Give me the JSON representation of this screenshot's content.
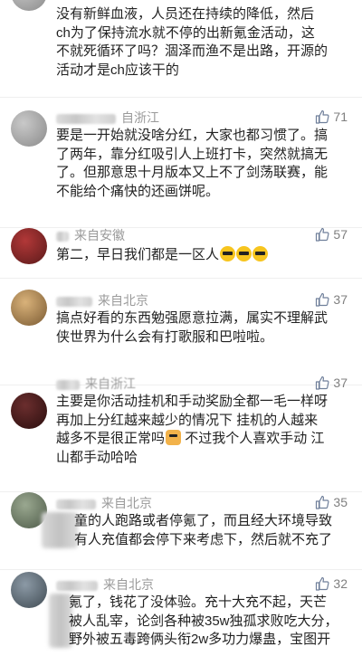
{
  "comments": [
    {
      "region": "",
      "likes": "",
      "lines": [
        "没有新鲜血液，人员还在持续的降低，然后",
        "ch为了保持流水就不停的出新氪金活动，这",
        "不就死循环了吗？涸泽而渔不是出路，开源的",
        "活动才是ch应该干的"
      ]
    },
    {
      "region": "自浙江",
      "likes": "71",
      "lines": [
        "要是一开始就没啥分红，大家也都习惯了。搞",
        "了两年，靠分红吸引人上班打卡，突然就搞无",
        "了。但那意思十月版本又上不了剑荡联赛，能",
        "不能给个痛快的还画饼呢。"
      ]
    },
    {
      "region": "来自安徽",
      "likes": "57",
      "lines": [
        "第二，早日我们都是一区人"
      ]
    },
    {
      "region": "来自北京",
      "likes": "37",
      "lines": [
        "搞点好看的东西勉强愿意拉满，属实不理解武",
        "侠世界为什么会有打歌服和巴啦啦。"
      ]
    },
    {
      "region": "来自浙江",
      "likes": "37",
      "lines": [
        "主要是你活动挂机和手动奖励全都一毛一样呀",
        "再加上分红越来越少的情况下 挂机的人越来",
        "越多不是很正常吗",
        "不过我个人喜欢手动 江",
        "山都手动哈哈"
      ]
    },
    {
      "region": "来自北京",
      "likes": "35",
      "lines": [
        "童的人跑路或者停氪了，而且经大环境导致",
        "有人充值都会停下来考虑下，然后就不充了"
      ]
    },
    {
      "region": "来自北京",
      "likes": "32",
      "lines": [
        "氪了，钱花了没体验。充十大充不起，天芒",
        "被人乱宰，论剑各种被35w独孤求败吃大分，",
        "野外被五毒跨俩头衔2w多功力爆蛊，宝图开"
      ]
    }
  ]
}
